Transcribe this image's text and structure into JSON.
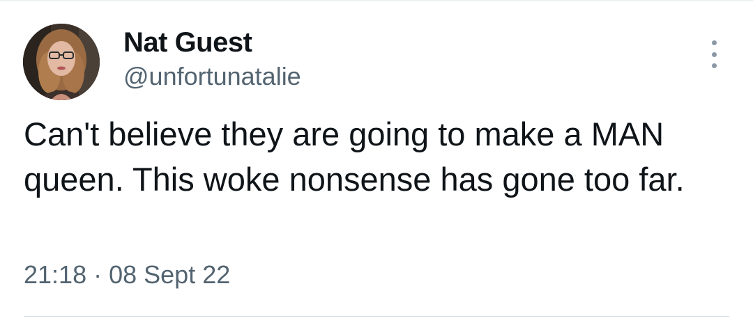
{
  "tweet": {
    "author": {
      "display_name": "Nat Guest",
      "handle": "@unfortunatalie",
      "avatar_icon": "profile-photo"
    },
    "more_icon": "more-options-vertical-icon",
    "text": "Can't believe they are going to make a MAN queen. This woke nonsense has gone too far.",
    "time": "21:18",
    "separator": "·",
    "date": "08 Sept 22"
  },
  "colors": {
    "primary_text": "#0f1419",
    "secondary_text": "#536471",
    "divider": "#cfd9de"
  }
}
